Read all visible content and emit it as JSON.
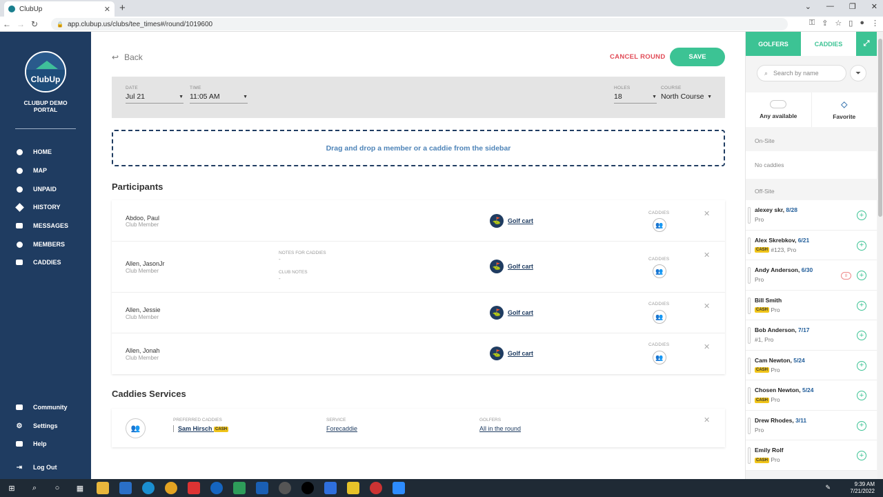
{
  "browser": {
    "tab_title": "ClubUp",
    "url": "app.clubup.us/clubs/tee_times#/round/1019600"
  },
  "sidebar": {
    "logo_text": "ClubUp",
    "portal_name": "CLUBUP DEMO PORTAL",
    "nav": [
      {
        "label": "HOME",
        "icon": "pin-icon"
      },
      {
        "label": "MAP",
        "icon": "map-icon"
      },
      {
        "label": "UNPAID",
        "icon": "unpaid-icon"
      },
      {
        "label": "HISTORY",
        "icon": "history-icon"
      },
      {
        "label": "MESSAGES",
        "icon": "messages-icon"
      },
      {
        "label": "MEMBERS",
        "icon": "members-icon"
      },
      {
        "label": "CADDIES",
        "icon": "caddies-icon"
      }
    ],
    "footer": [
      {
        "label": "Community",
        "icon": "community-icon"
      },
      {
        "label": "Settings",
        "icon": "settings-icon"
      },
      {
        "label": "Help",
        "icon": "help-icon"
      },
      {
        "label": "Log Out",
        "icon": "logout-icon"
      }
    ]
  },
  "header": {
    "back_label": "Back",
    "cancel_label": "CANCEL ROUND",
    "save_label": "SAVE"
  },
  "filters": {
    "date_label": "DATE",
    "date_value": "Jul 21",
    "time_label": "TIME",
    "time_value": "11:05 AM",
    "holes_label": "HOLES",
    "holes_value": "18",
    "course_label": "COURSE",
    "course_value": "North Course"
  },
  "dropzone_text": "Drag and drop a member or a caddie from the sidebar",
  "participants_title": "Participants",
  "participants": [
    {
      "name": "Abdoo, Paul",
      "role": "Club Member",
      "cart": "Golf cart",
      "caddies_label": "CADDIES"
    },
    {
      "name": "Allen, JasonJr",
      "role": "Club Member",
      "cart": "Golf cart",
      "caddies_label": "CADDIES",
      "notes_label": "NOTES FOR CADDIES",
      "notes_value": "-",
      "club_notes_label": "CLUB NOTES",
      "club_notes_value": "-"
    },
    {
      "name": "Allen, Jessie",
      "role": "Club Member",
      "cart": "Golf cart",
      "caddies_label": "CADDIES"
    },
    {
      "name": "Allen, Jonah",
      "role": "Club Member",
      "cart": "Golf cart",
      "caddies_label": "CADDIES"
    }
  ],
  "services_title": "Caddies Services",
  "services": {
    "preferred_label": "PREFERRED CADDIES",
    "preferred_value": "Sam Hirsch",
    "preferred_badge": "CASH",
    "service_label": "SERVICE",
    "service_value": "Forecaddie",
    "golfers_label": "GOLFERS",
    "golfers_value": "All in the round"
  },
  "right_panel": {
    "tab_golfers": "GOLFERS",
    "tab_caddies": "CADDIES",
    "search_placeholder": "Search by name",
    "any_available": "Any available",
    "favorite": "Favorite",
    "onsite_label": "On-Site",
    "no_caddies": "No caddies",
    "offsite_label": "Off-Site",
    "caddies": [
      {
        "name": "alexey skr",
        "date": "8/28",
        "cash": "",
        "sub": "Pro"
      },
      {
        "name": "Alex Skrebkov",
        "date": "6/21",
        "cash": "CASH",
        "sub": "#123, Pro"
      },
      {
        "name": "Andy Anderson",
        "date": "6/30",
        "cash": "",
        "sub": "Pro",
        "badge": "8"
      },
      {
        "name": "Bill Smith",
        "date": "",
        "cash": "CASH",
        "sub": "Pro"
      },
      {
        "name": "Bob Anderson",
        "date": "7/17",
        "cash": "",
        "sub": "#1, Pro"
      },
      {
        "name": "Cam Newton",
        "date": "5/24",
        "cash": "CASH",
        "sub": "Pro"
      },
      {
        "name": "Chosen Newton",
        "date": "5/24",
        "cash": "CASH",
        "sub": "Pro"
      },
      {
        "name": "Drew Rhodes",
        "date": "3/11",
        "cash": "",
        "sub": "Pro"
      },
      {
        "name": "Emily Rolf",
        "date": "",
        "cash": "CASH",
        "sub": "Pro"
      }
    ]
  },
  "taskbar": {
    "time": "9:39 AM",
    "date": "7/21/2022"
  },
  "colors": {
    "sidebar": "#1f3c61",
    "accent": "#3cc394",
    "danger": "#e14a56",
    "cash_badge": "#f0c419"
  }
}
